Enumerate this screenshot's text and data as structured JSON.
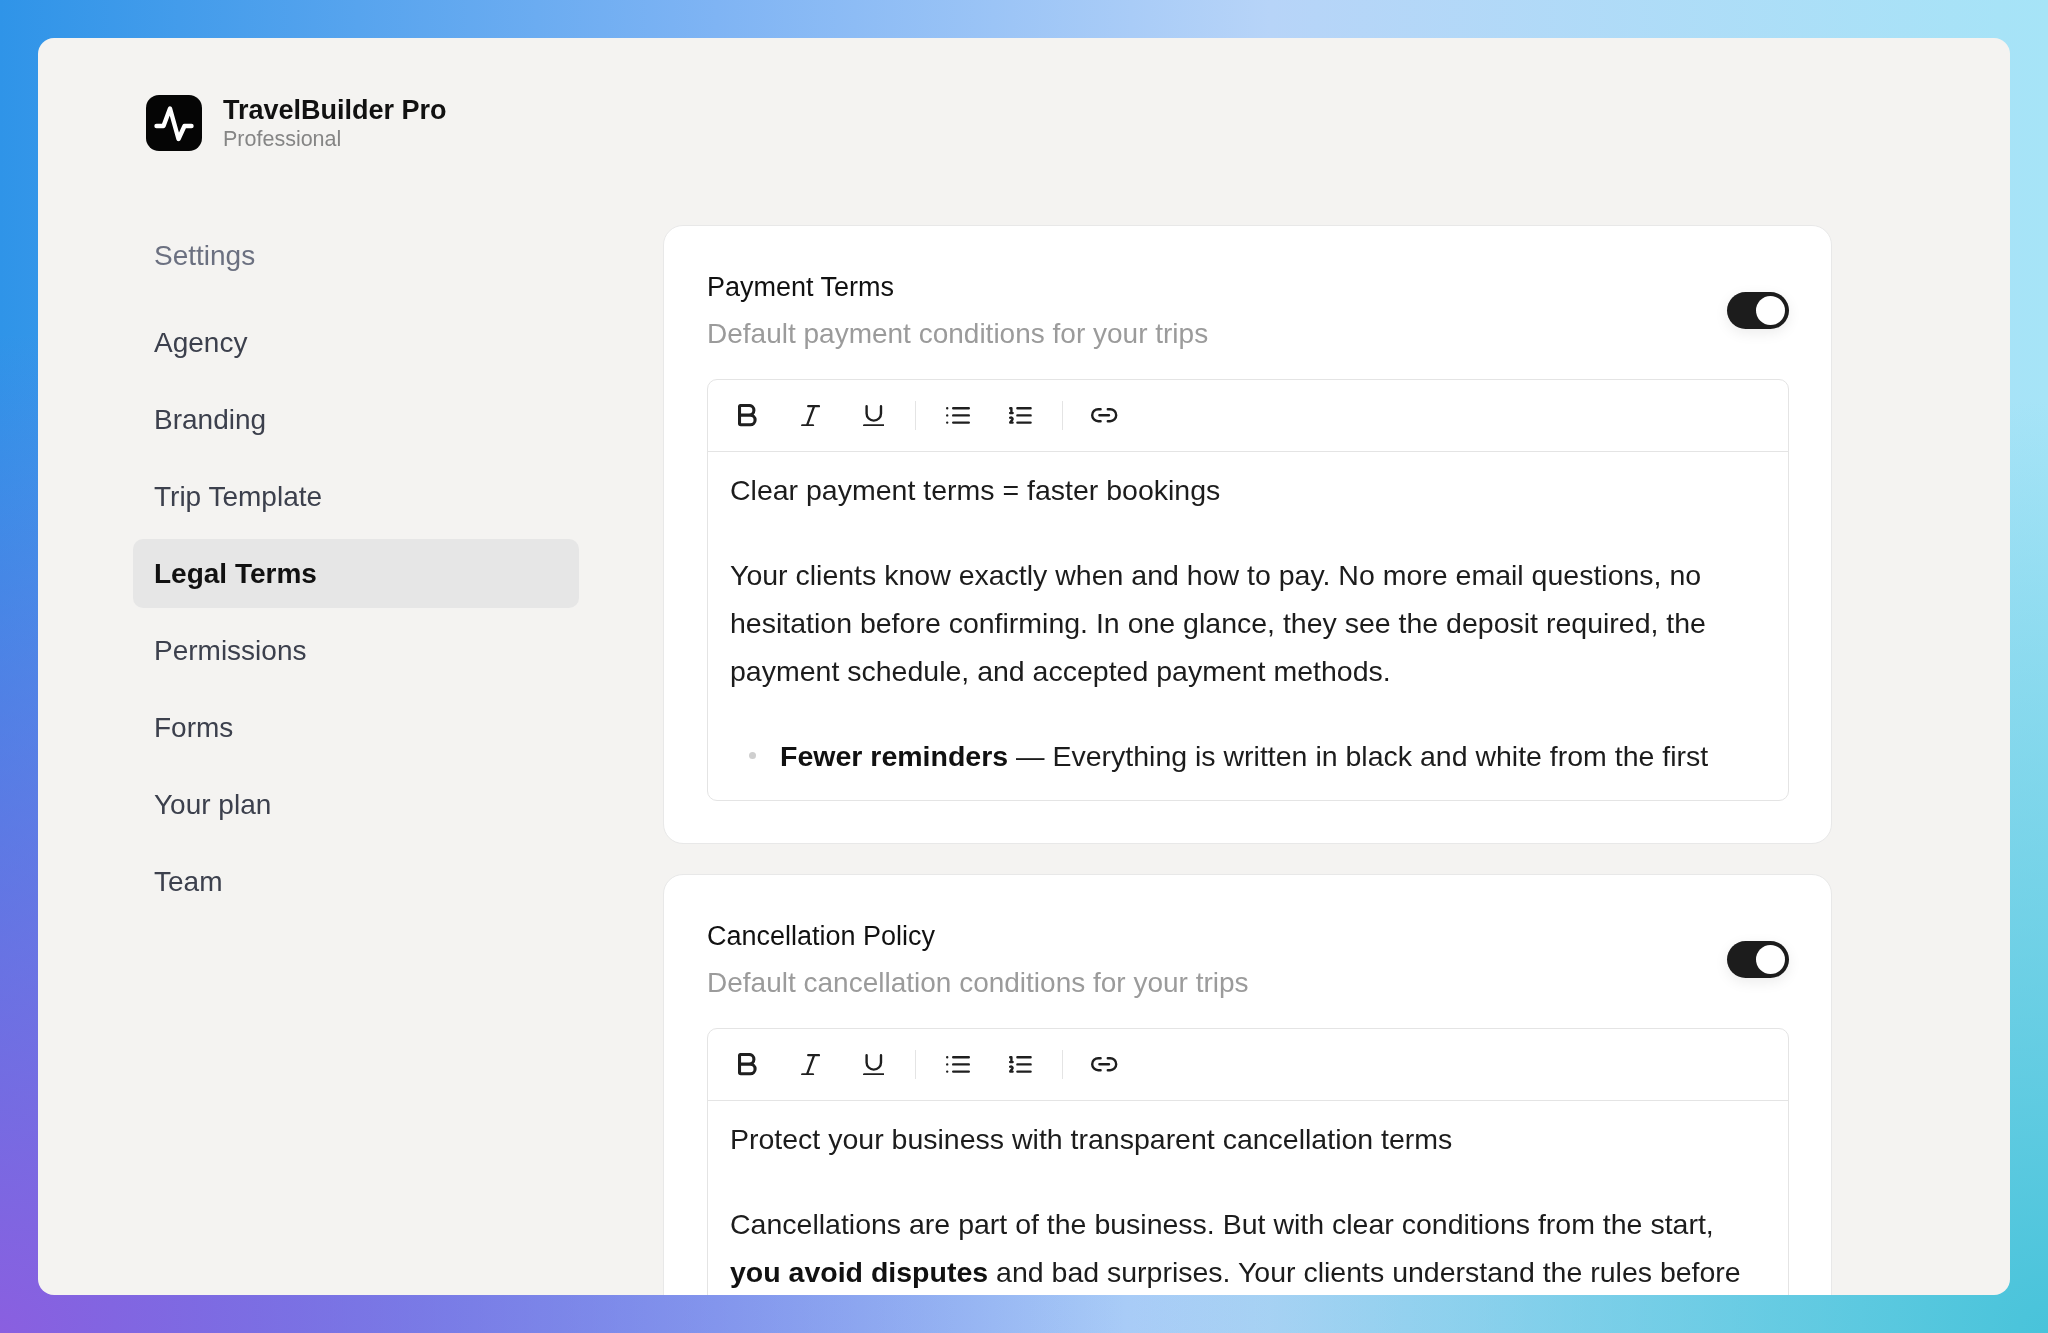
{
  "app": {
    "name": "TravelBuilder Pro",
    "plan": "Professional"
  },
  "sidebar": {
    "heading": "Settings",
    "items": [
      {
        "label": "Agency",
        "selected": false
      },
      {
        "label": "Branding",
        "selected": false
      },
      {
        "label": "Trip Template",
        "selected": false
      },
      {
        "label": "Legal Terms",
        "selected": true
      },
      {
        "label": "Permissions",
        "selected": false
      },
      {
        "label": "Forms",
        "selected": false
      },
      {
        "label": "Your plan",
        "selected": false
      },
      {
        "label": "Team",
        "selected": false
      }
    ]
  },
  "sections": [
    {
      "title": "Payment Terms",
      "description": "Default payment conditions for your trips",
      "on": true,
      "editor": {
        "blocks": [
          {
            "kind": "paragraph",
            "text": "Clear payment terms = faster bookings"
          },
          {
            "kind": "paragraph",
            "text": "Your clients know exactly when and how to pay. No more email questions, no hesitation before confirming. In one glance, they see the deposit required, the payment schedule, and accepted payment methods."
          },
          {
            "kind": "bullet",
            "text": "**Fewer reminders** — Everything is written in black and white from the first"
          }
        ]
      }
    },
    {
      "title": "Cancellation Policy",
      "description": "Default cancellation conditions for your trips",
      "on": true,
      "editor": {
        "blocks": [
          {
            "kind": "paragraph",
            "text": "Protect your business with transparent cancellation terms"
          },
          {
            "kind": "paragraph",
            "text": "Cancellations are part of the business. But with clear conditions from the start, **you avoid disputes** and bad surprises. Your clients understand the rules before"
          }
        ]
      }
    }
  ]
}
